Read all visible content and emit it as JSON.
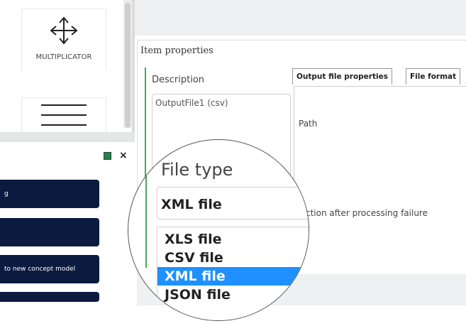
{
  "palette": {
    "tool_label": "MULTIPLICATOR",
    "icons": {
      "move": "move-arrows-icon",
      "menu": "hamburger-menu-icon"
    }
  },
  "actions": {
    "items": [
      {
        "label": "g"
      },
      {
        "label": ""
      },
      {
        "label": "to new concept model"
      },
      {
        "label": ""
      }
    ],
    "close_label": "×"
  },
  "properties": {
    "title": "Item properties",
    "description_label": "Description",
    "description_value": "OutputFile1 (csv)",
    "tabs": [
      {
        "label": "Output file properties",
        "active": true
      },
      {
        "label": "File format",
        "active": false
      }
    ],
    "path_label": "Path",
    "failure_label": "Action after processing failure"
  },
  "magnifier": {
    "file_type_label": "File type",
    "selected_value": "XML file",
    "options": [
      "XLS file",
      "CSV file",
      "XML file",
      "JSON file"
    ],
    "highlighted_option": "XML file"
  },
  "colors": {
    "action_button_bg": "#0b1b3f",
    "highlight": "#1e90ff",
    "green_accent": "#4aa65a"
  }
}
